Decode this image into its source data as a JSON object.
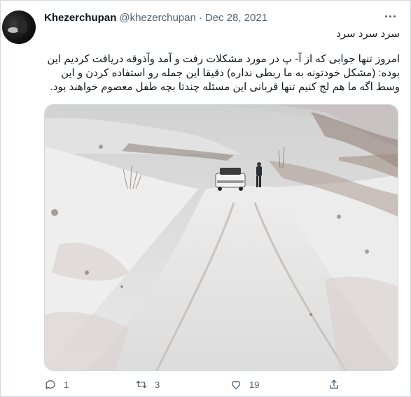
{
  "tweet": {
    "display_name": "Khezerchupan",
    "handle": "@khezerchupan",
    "separator": "·",
    "date": "Dec 28, 2021",
    "text_line1": "سرد سرد سرد",
    "text_line2": "امروز تنها جوابی که از آ- پ در مورد مشکلات رفت و آمد وآذوقه دریافت کردیم این بوده: (مشکل خودتونه به ما ربطی نداره) دقیقا این جمله رو استفاده کردن و این وسط اگه ما هم لج کنیم تنها قربانی این مسئله چندتا بچه طفل معصوم خواهند بود."
  },
  "actions": {
    "reply_count": "1",
    "retweet_count": "3",
    "like_count": "19"
  },
  "icons": {
    "reply": "speech-bubble-icon",
    "retweet": "retweet-arrows-icon",
    "like": "heart-icon",
    "share": "share-upload-icon",
    "more": "more-dots-icon"
  },
  "colors": {
    "text_primary": "#0f1419",
    "text_secondary": "#536471",
    "border": "#cfd9de"
  }
}
